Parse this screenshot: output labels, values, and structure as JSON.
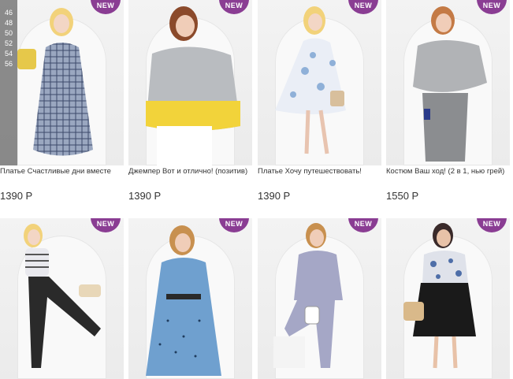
{
  "badge_label": "NEW",
  "currency": "Р",
  "sizes": [
    "46",
    "48",
    "50",
    "52",
    "54",
    "56"
  ],
  "products": [
    {
      "title": "Платье Счастливые дни вместе",
      "price": "1390 Р",
      "outfit": "checked-dress"
    },
    {
      "title": "Джемпер Вот и отлично! (позитив)",
      "price": "1390 Р",
      "outfit": "grey-yellow-sweater"
    },
    {
      "title": "Платье Хочу путешествовать!",
      "price": "1390 Р",
      "outfit": "dotted-dress"
    },
    {
      "title": "Костюм Ваш ход! (2 в 1, нью грей)",
      "price": "1550 Р",
      "outfit": "grey-suit"
    },
    {
      "title": "",
      "price": "",
      "outfit": "striped-top-black-pants"
    },
    {
      "title": "",
      "price": "",
      "outfit": "blue-polka-dress"
    },
    {
      "title": "",
      "price": "",
      "outfit": "lavender-suit"
    },
    {
      "title": "",
      "price": "",
      "outfit": "floral-top-black-skirt"
    }
  ],
  "colors": {
    "badge": "#8a3d93",
    "text": "#333333",
    "size_panel": "#787878"
  }
}
